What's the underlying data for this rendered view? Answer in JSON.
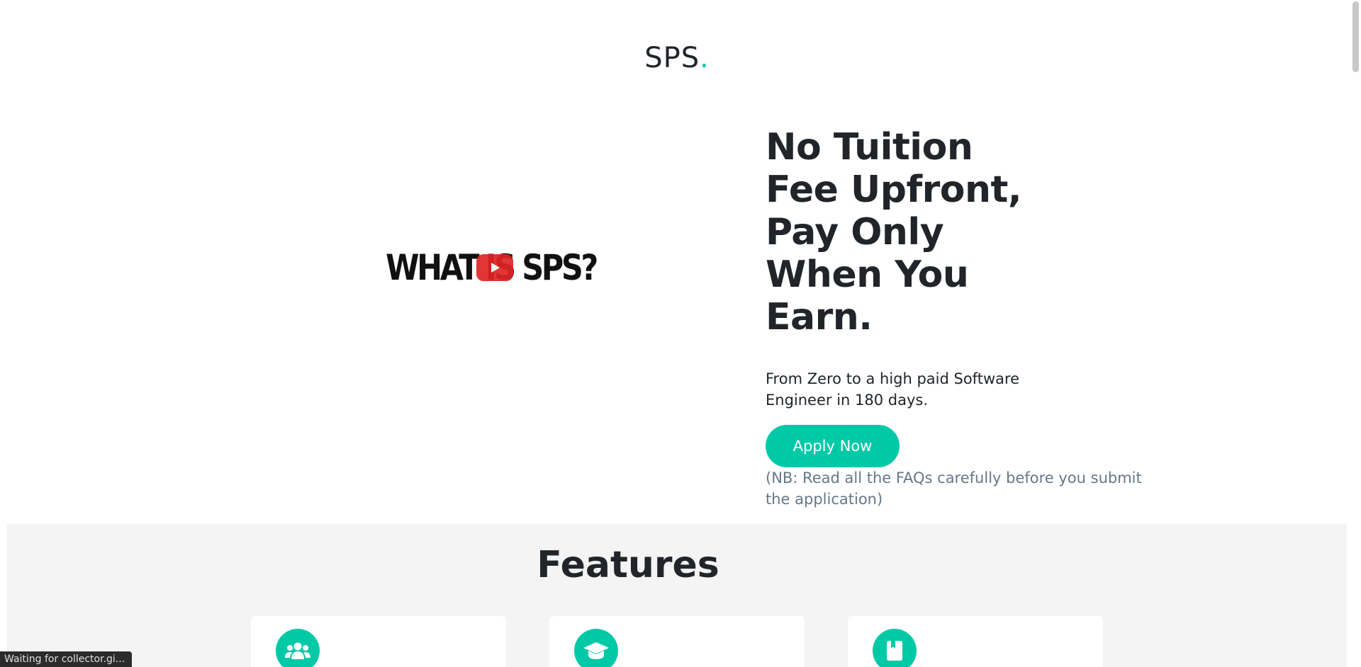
{
  "header": {
    "logo_text": "SPS",
    "logo_dot": "."
  },
  "hero": {
    "video_title": "WHAT IS SPS?",
    "title": "No Tuition Fee Upfront, Pay Only When You Earn.",
    "subtitle": "From Zero to a high paid Software Engineer in 180 days.",
    "apply_label": "Apply Now",
    "note": "(NB: Read all the FAQs carefully before you submit the application)"
  },
  "features": {
    "title": "Features",
    "cards": [
      {
        "icon": "people-icon"
      },
      {
        "icon": "graduation-cap-icon"
      },
      {
        "icon": "book-icon"
      }
    ]
  },
  "status_bar": {
    "text": "Waiting for collector.gi..."
  },
  "colors": {
    "accent": "#00c9a7",
    "muted_text": "#677788",
    "section_bg": "#f4f4f4",
    "youtube_red": "#e02424"
  }
}
